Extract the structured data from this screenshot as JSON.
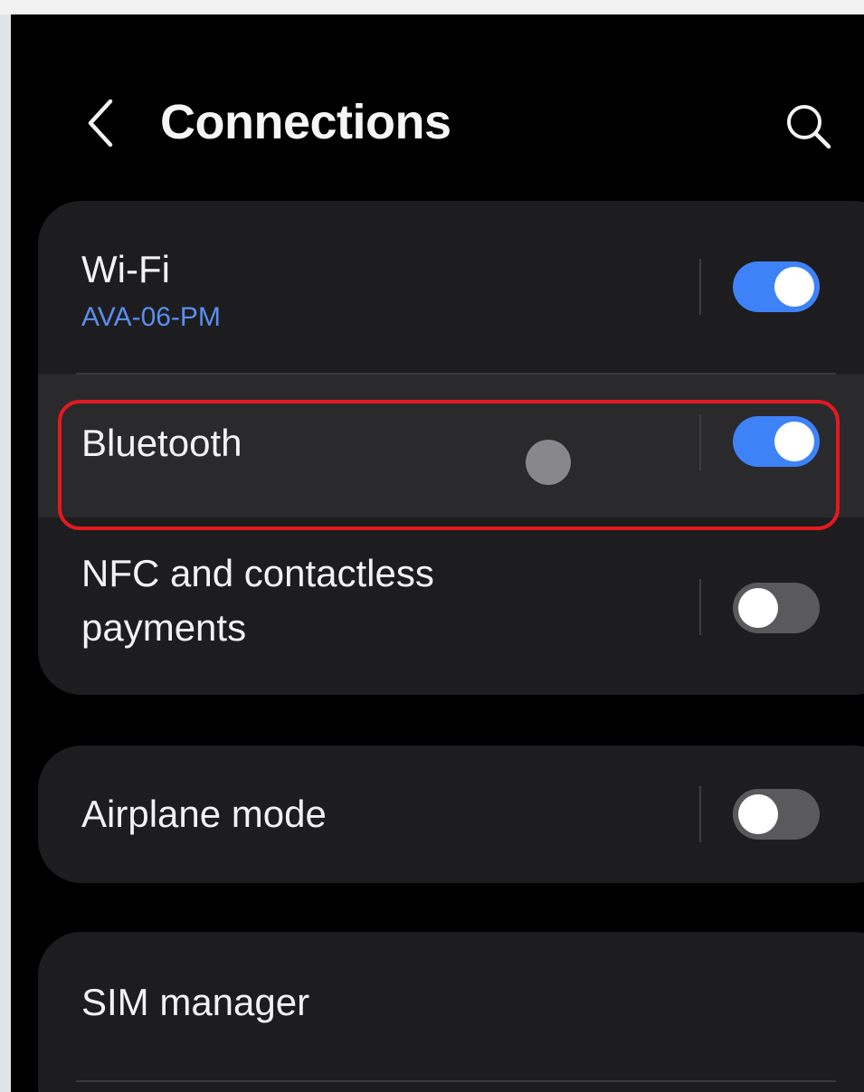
{
  "header": {
    "title": "Connections",
    "back_icon": "chevron-left-icon",
    "search_icon": "search-icon"
  },
  "connections_group": {
    "wifi": {
      "label": "Wi-Fi",
      "network": "AVA-06-PM",
      "enabled": true
    },
    "bluetooth": {
      "label": "Bluetooth",
      "enabled": true
    },
    "nfc": {
      "label_line1": "NFC and contactless",
      "label_line2": "payments",
      "enabled": false
    }
  },
  "airplane_group": {
    "airplane": {
      "label": "Airplane mode",
      "enabled": false
    }
  },
  "sim_group": {
    "sim_manager": {
      "label": "SIM manager"
    }
  },
  "colors": {
    "accent": "#3e82f7",
    "network_text": "#5b8def",
    "highlight": "#e5181f",
    "background": "#000000",
    "card": "#1d1d1f"
  }
}
